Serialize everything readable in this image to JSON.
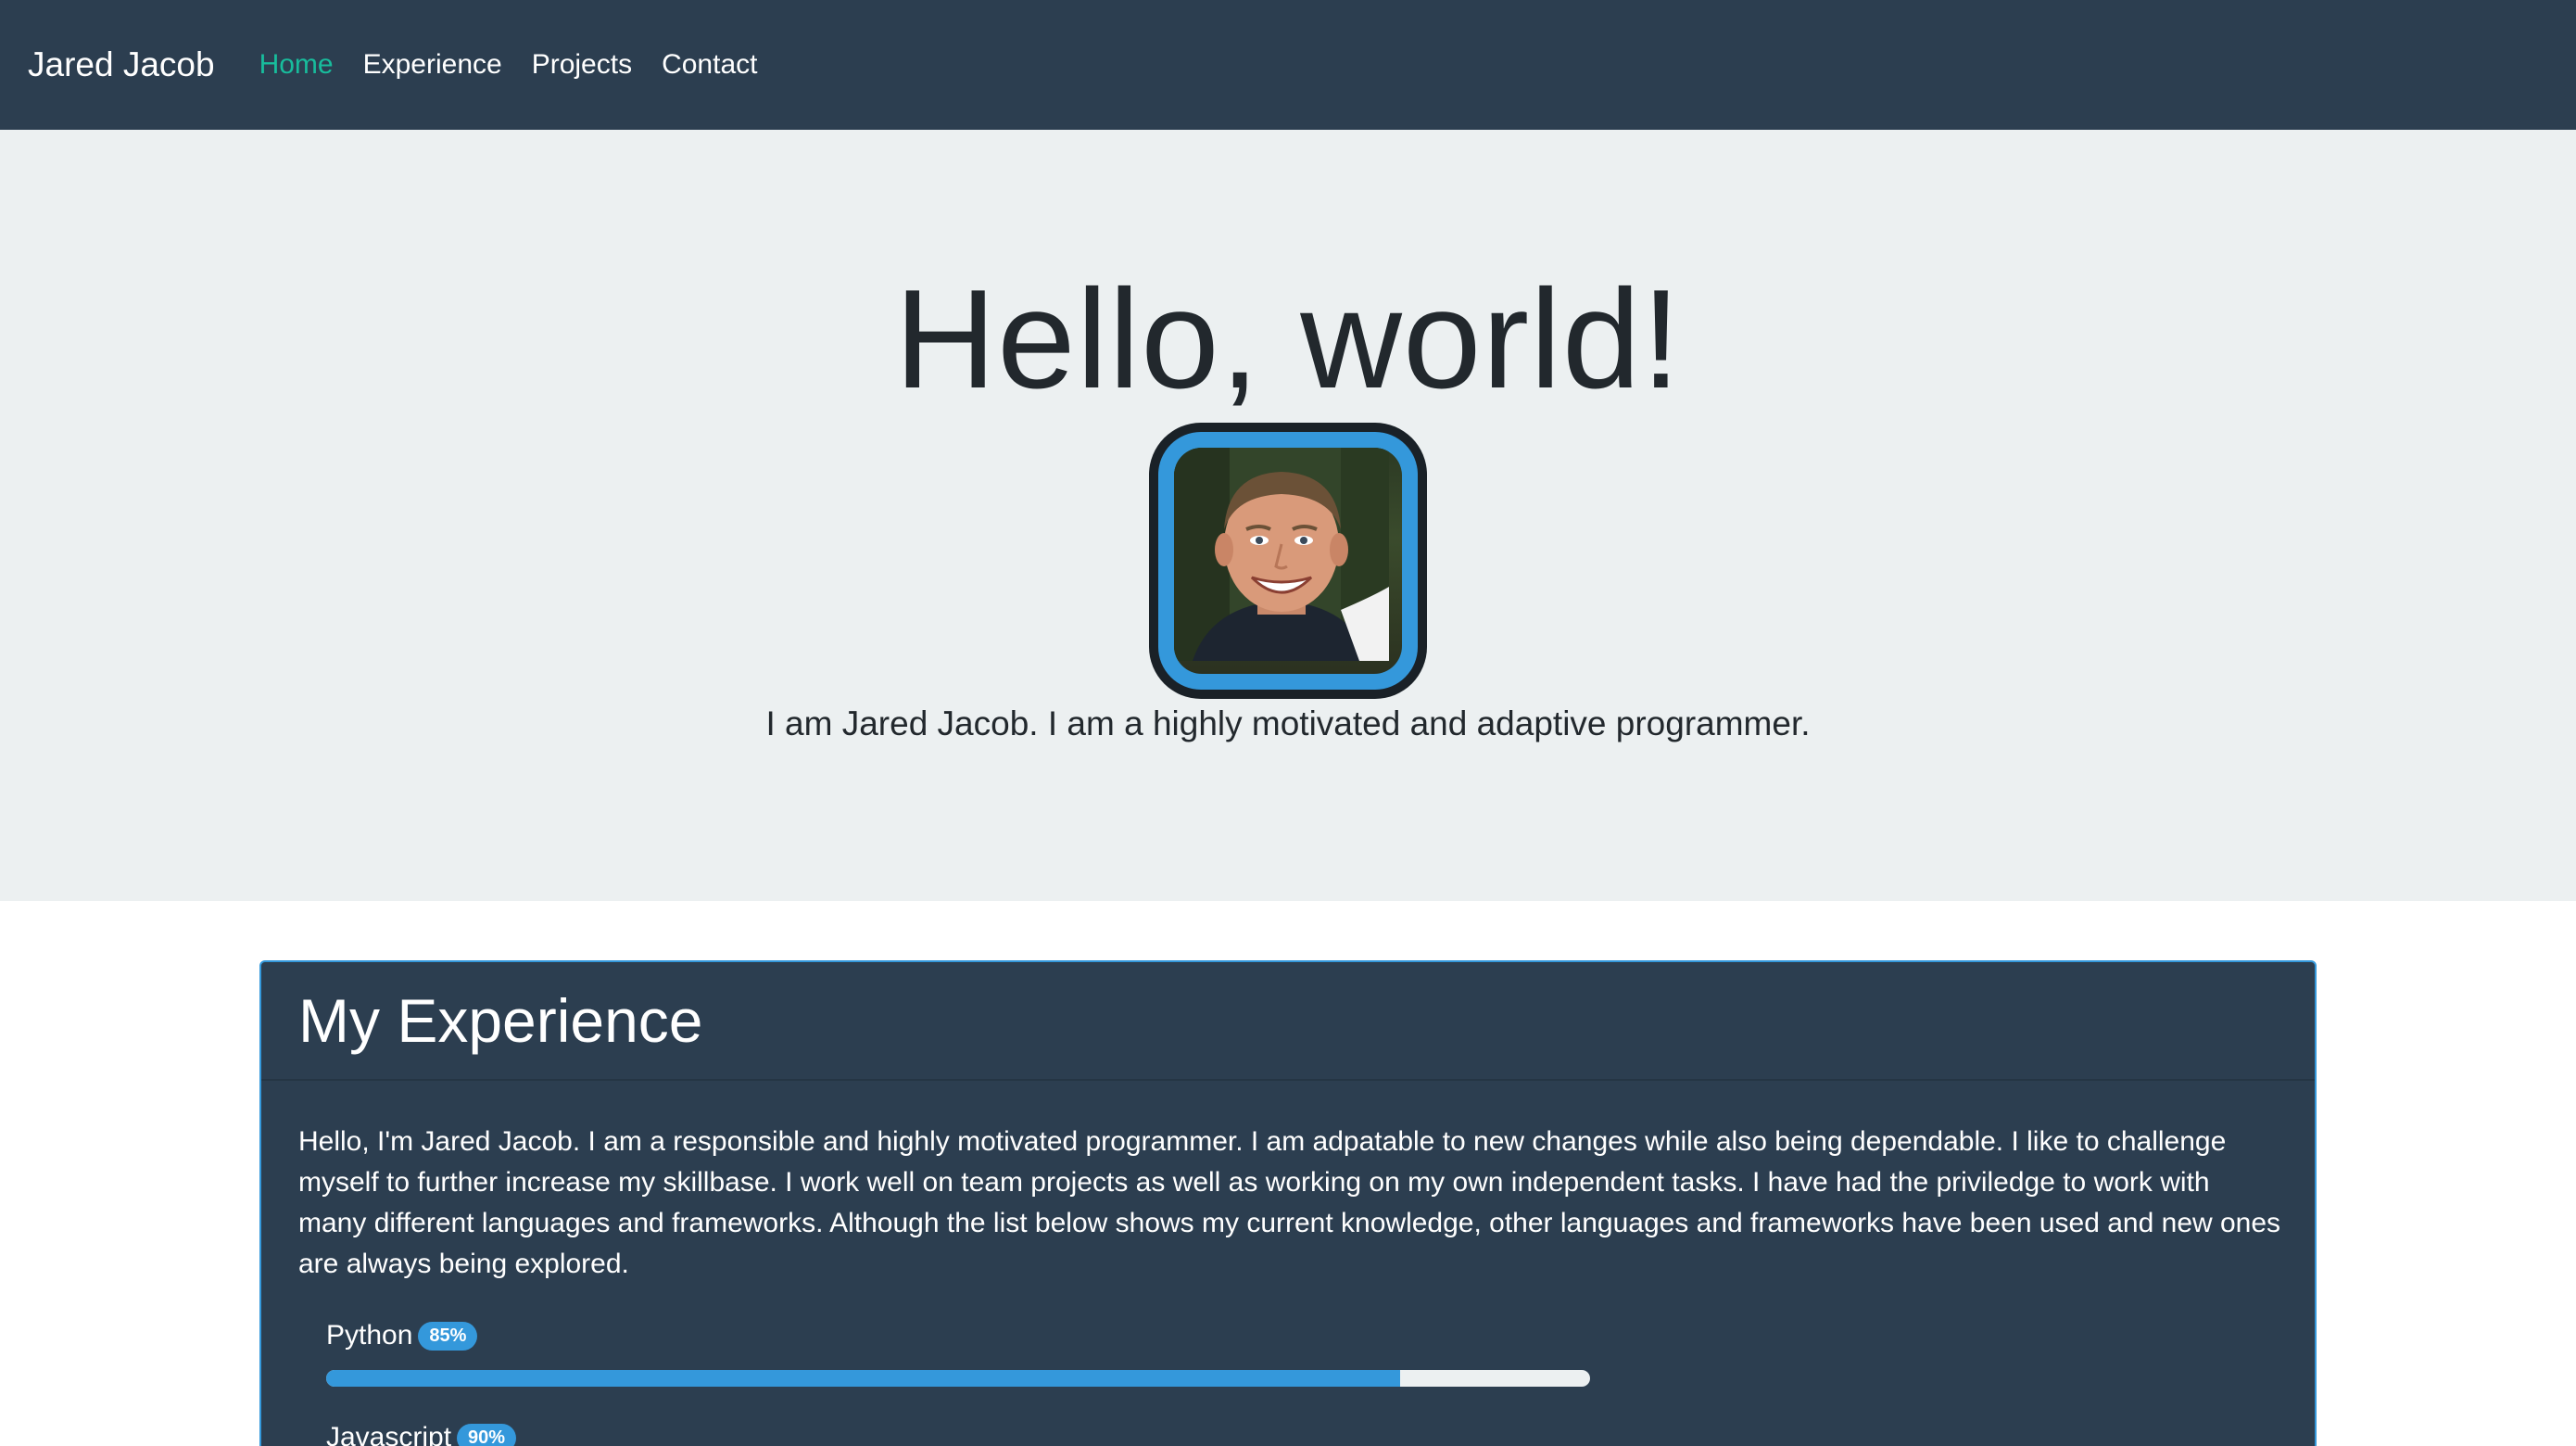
{
  "navbar": {
    "brand": "Jared Jacob",
    "links": [
      {
        "label": "Home",
        "active": true
      },
      {
        "label": "Experience",
        "active": false
      },
      {
        "label": "Projects",
        "active": false
      },
      {
        "label": "Contact",
        "active": false
      }
    ]
  },
  "hero": {
    "title": "Hello, world!",
    "subtitle": "I am Jared Jacob. I am a highly motivated and adaptive programmer."
  },
  "experience": {
    "title": "My Experience",
    "text": "Hello, I'm Jared Jacob. I am a responsible and highly motivated programmer. I am adpatable to new changes while also being dependable. I like to challenge myself to further increase my skillbase. I work well on team projects as well as working on my own independent tasks. I have had the priviledge to work with many different languages and frameworks. Although the list below shows my current knowledge, other languages and frameworks have been used and new ones are always being explored.",
    "skills": [
      {
        "name": "Python",
        "badge": "85%",
        "value": 85
      },
      {
        "name": "Javascript",
        "badge": "90%",
        "value": 90
      }
    ]
  },
  "colors": {
    "navbar": "#2c3e50",
    "accent": "#18bc9c",
    "primary": "#3498db",
    "hero_bg": "#ecf0f1"
  }
}
